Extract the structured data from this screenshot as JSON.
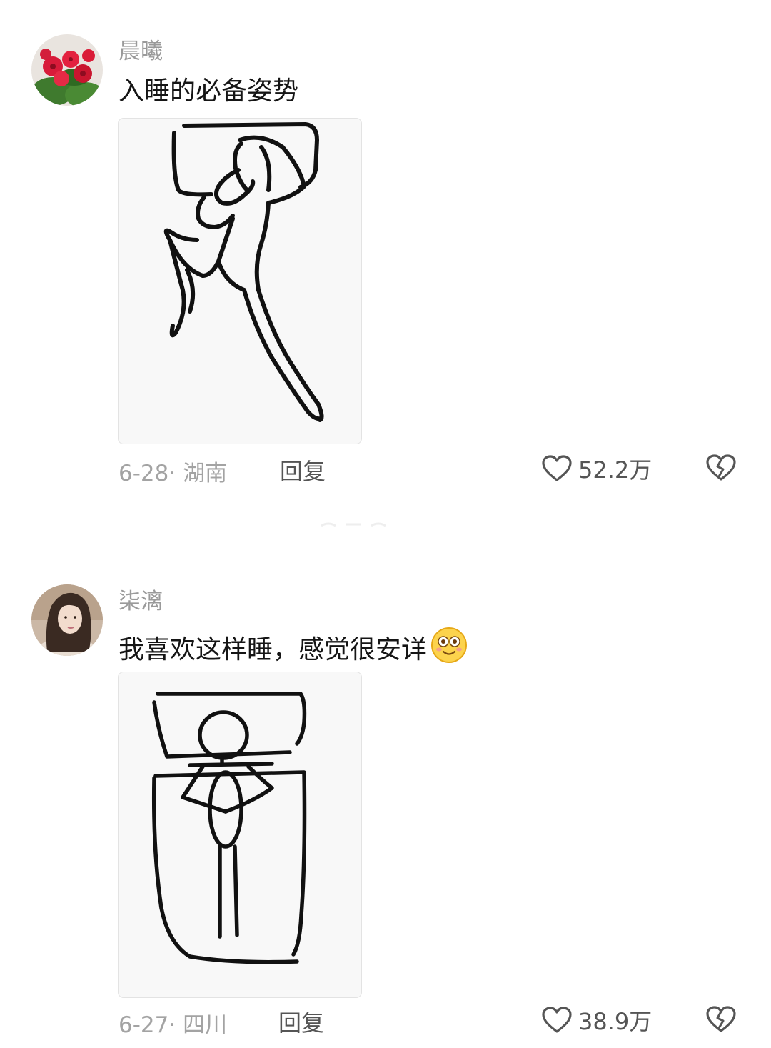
{
  "comments": [
    {
      "username": "晨曦",
      "text": "入睡的必备姿势",
      "avatar_icon": "red-flowers-avatar",
      "image_icon": "sleeping-pose-sketch",
      "date_location": "6-28· 湖南",
      "reply_label": "回复",
      "like_count": "52.2万"
    },
    {
      "username": "柒漓",
      "text": "我喜欢这样睡，感觉很安详",
      "emoji_icon": "smiling-emoji",
      "avatar_icon": "girl-portrait-avatar",
      "image_icon": "sleeping-straight-sketch",
      "date_location": "6-27· 四川",
      "reply_label": "回复",
      "like_count": "38.9万"
    }
  ],
  "colors": {
    "username": "#9a9a9a",
    "meta": "#a3a3a3",
    "action": "#555555"
  }
}
